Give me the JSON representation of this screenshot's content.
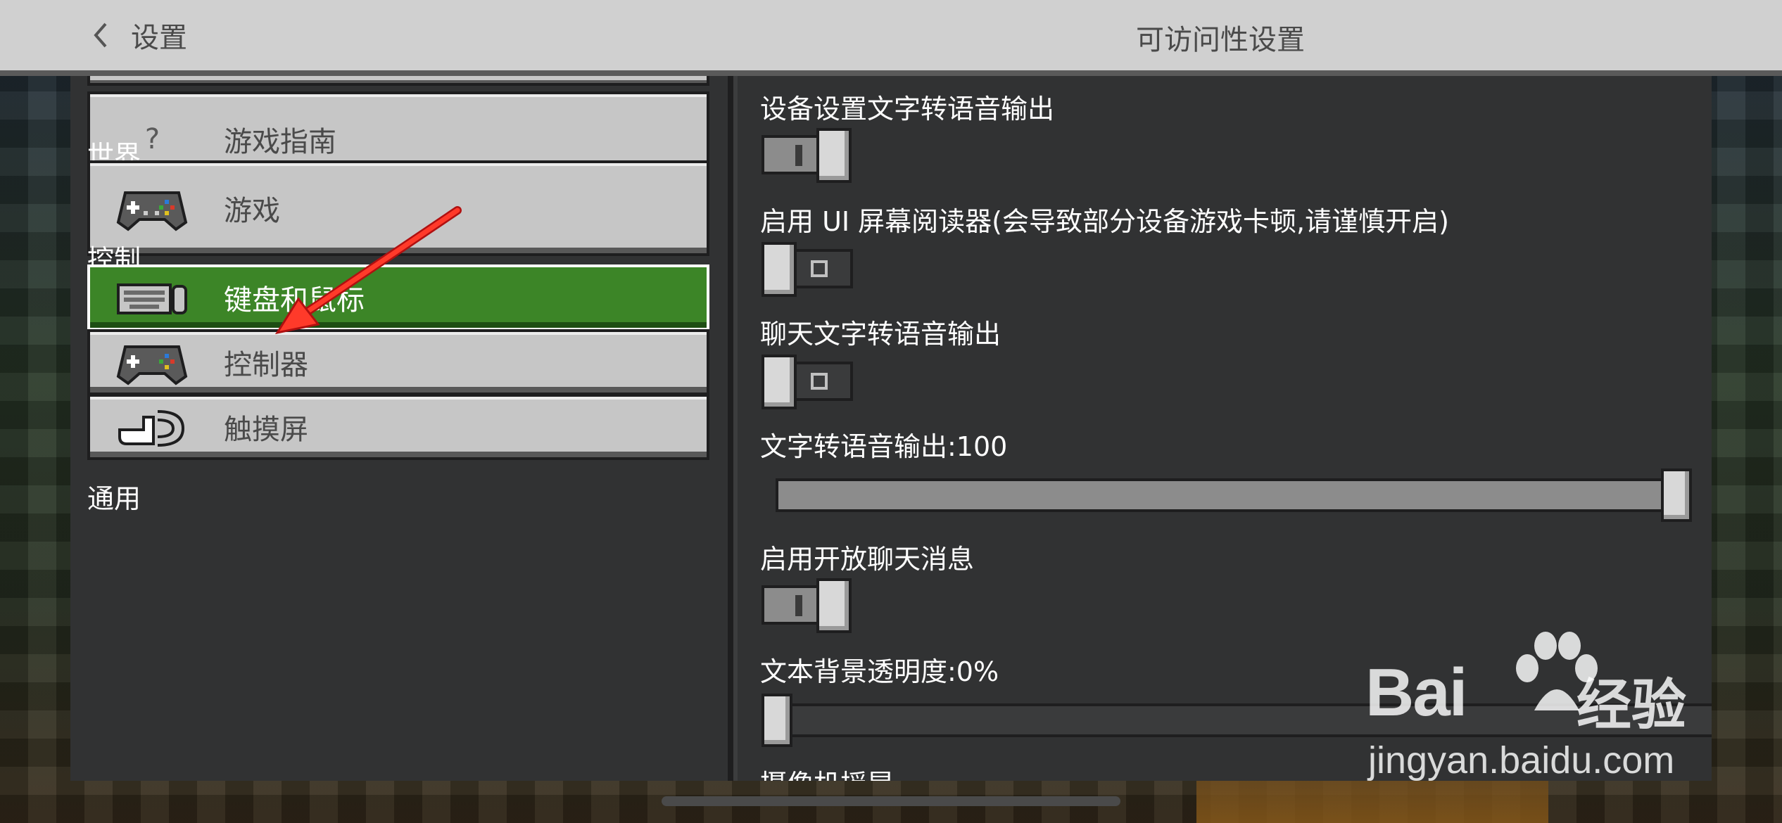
{
  "header": {
    "back_label": "设置",
    "title": "可访问性设置"
  },
  "sidebar": {
    "items_top": [
      {
        "label": "游戏指南",
        "icon": "question-icon"
      }
    ],
    "sections": [
      {
        "title": "世界",
        "items": [
          {
            "label": "游戏",
            "icon": "gamepad-icon"
          }
        ]
      },
      {
        "title": "控制",
        "items": [
          {
            "label": "键盘和鼠标",
            "icon": "keyboard-mouse-icon",
            "active": true
          },
          {
            "label": "控制器",
            "icon": "gamepad-icon"
          },
          {
            "label": "触摸屏",
            "icon": "touch-icon"
          }
        ]
      },
      {
        "title": "通用"
      }
    ]
  },
  "settings": {
    "device_tts": {
      "label": "设备设置文字转语音输出",
      "value": "on"
    },
    "ui_reader": {
      "label": "启用 UI 屏幕阅读器(会导致部分设备游戏卡顿,请谨慎开启)",
      "value": "off"
    },
    "chat_tts": {
      "label": "聊天文字转语音输出",
      "value": "off"
    },
    "tts_volume": {
      "label": "文字转语音输出:100",
      "value": 100,
      "max": 100
    },
    "open_chat": {
      "label": "启用开放聊天消息",
      "value": "on"
    },
    "text_bg_opacity": {
      "label": "文本背景透明度:0%",
      "value": 0,
      "max": 100
    },
    "camera_shake": {
      "label": "摄像机摇晃"
    }
  },
  "watermark": {
    "brand": "Bai",
    "brand_tail": "经验",
    "url": "jingyan.baidu.com"
  },
  "colors": {
    "active_green": "#3c8527",
    "panel": "#313233",
    "button": "#c6c6c6",
    "arrow": "#e8231c"
  }
}
